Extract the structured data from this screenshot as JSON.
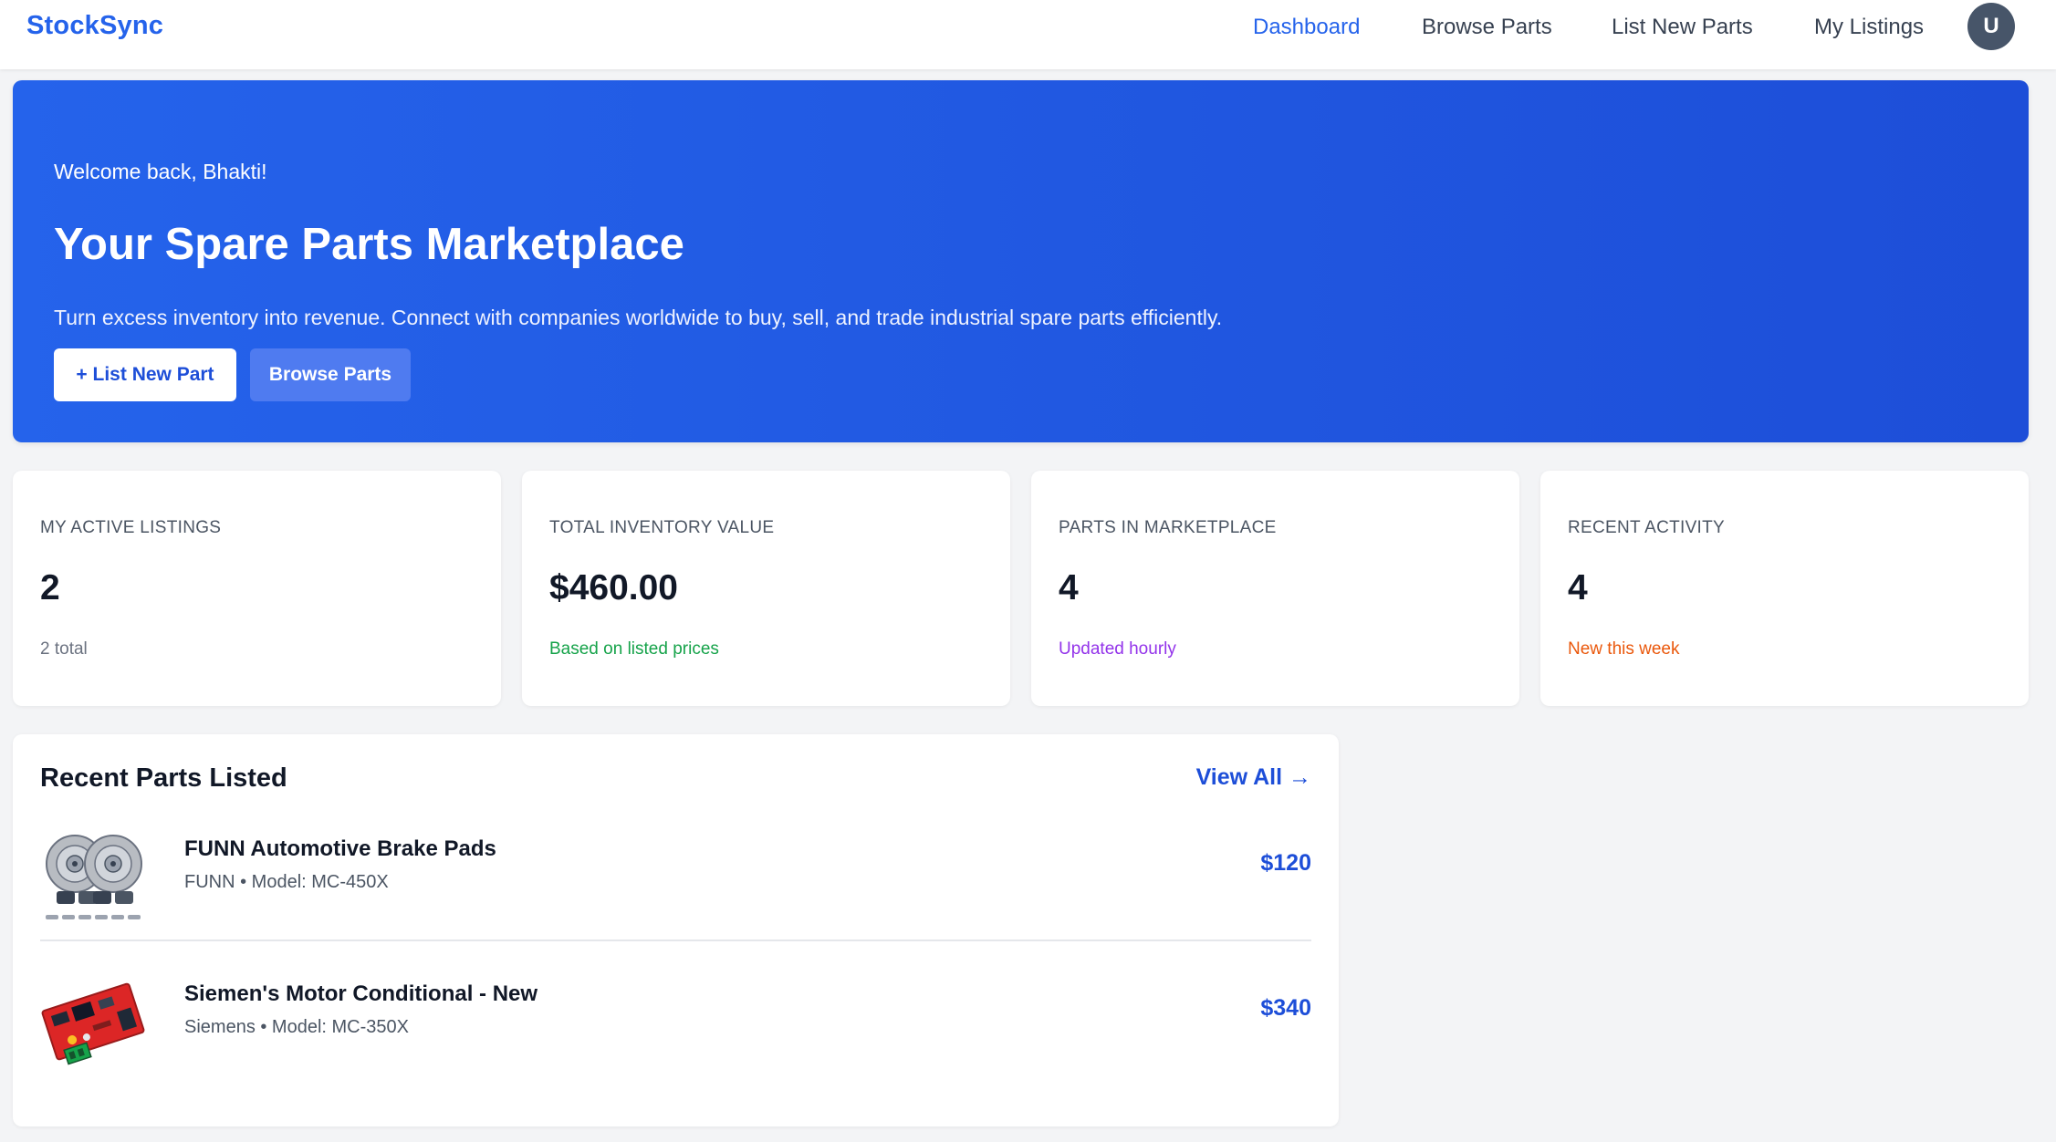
{
  "app": {
    "brand": "StockSync"
  },
  "nav": {
    "items": [
      {
        "label": "Dashboard",
        "active": true
      },
      {
        "label": "Browse Parts",
        "active": false
      },
      {
        "label": "List New Parts",
        "active": false
      },
      {
        "label": "My Listings",
        "active": false
      }
    ],
    "avatar_initial": "U"
  },
  "hero": {
    "welcome": "Welcome back, Bhakti!",
    "title": "Your Spare Parts Marketplace",
    "description": "Turn excess inventory into revenue. Connect with companies worldwide to buy, sell, and trade industrial spare parts efficiently.",
    "primary_button": "+ List New Part",
    "secondary_button": "Browse Parts"
  },
  "stats": [
    {
      "label": "MY ACTIVE LISTINGS",
      "value": "2",
      "sub": "2 total",
      "sub_color": "#6b7280"
    },
    {
      "label": "TOTAL INVENTORY VALUE",
      "value": "$460.00",
      "sub": "Based on listed prices",
      "sub_color": "#16a34a"
    },
    {
      "label": "PARTS IN MARKETPLACE",
      "value": "4",
      "sub": "Updated hourly",
      "sub_color": "#9333ea"
    },
    {
      "label": "RECENT ACTIVITY",
      "value": "4",
      "sub": "New this week",
      "sub_color": "#ea580c"
    }
  ],
  "recent": {
    "title": "Recent Parts Listed",
    "view_all": "View All →",
    "parts": [
      {
        "name": "FUNN Automotive Brake Pads",
        "meta": "FUNN • Model: MC-450X",
        "price": "$120",
        "image": "brake-disc-thumbnail"
      },
      {
        "name": "Siemen's Motor Conditional - New",
        "meta": "Siemens • Model: MC-350X",
        "price": "$340",
        "image": "circuit-board-thumbnail"
      }
    ]
  },
  "colors": {
    "accent": "#2563eb",
    "hero_gradient_start": "#2563eb",
    "hero_gradient_end": "#1d4ed8",
    "price": "#1d4ed8"
  }
}
